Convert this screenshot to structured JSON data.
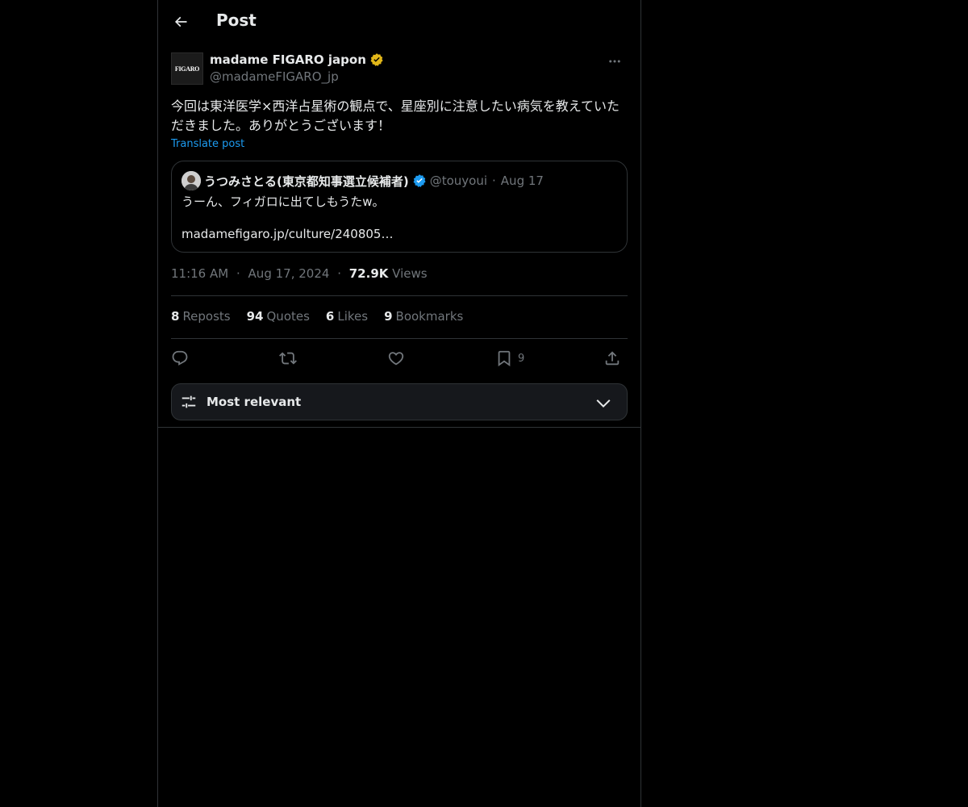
{
  "header": {
    "title": "Post",
    "back_icon": "arrow-left-icon"
  },
  "author": {
    "name": "madame FIGARO japon",
    "handle": "@madameFIGARO_jp",
    "avatar_text": "FIGARO",
    "verified_color": "#e2b719"
  },
  "post": {
    "text": "今回は東洋医学×西洋占星術の観点で、星座別に注意したい病気を教えていただきました。ありがとうございます！",
    "translate_label": "Translate post"
  },
  "quote": {
    "name": "うつみさとる(東京都知事選立候補者)",
    "handle": "@touyoui",
    "separator": "·",
    "date": "Aug 17",
    "text": "うーん、フィガロに出てしもうたw。",
    "link": "madamefigaro.jp/culture/240805…",
    "verified_color": "#1d9bf0"
  },
  "meta": {
    "time": "11:16 AM",
    "date": "Aug 17, 2024",
    "separator": "·",
    "views_count": "72.9K",
    "views_label": "Views"
  },
  "stats": {
    "reposts_count": "8",
    "reposts_label": "Reposts",
    "quotes_count": "94",
    "quotes_label": "Quotes",
    "likes_count": "6",
    "likes_label": "Likes",
    "bookmarks_count": "9",
    "bookmarks_label": "Bookmarks"
  },
  "actions": {
    "bookmark_count": "9"
  },
  "sort": {
    "label": "Most relevant"
  },
  "colors": {
    "background": "#000000",
    "text": "#e7e9ea",
    "muted": "#71767b",
    "accent": "#1d9bf0",
    "border": "#2f3336"
  }
}
